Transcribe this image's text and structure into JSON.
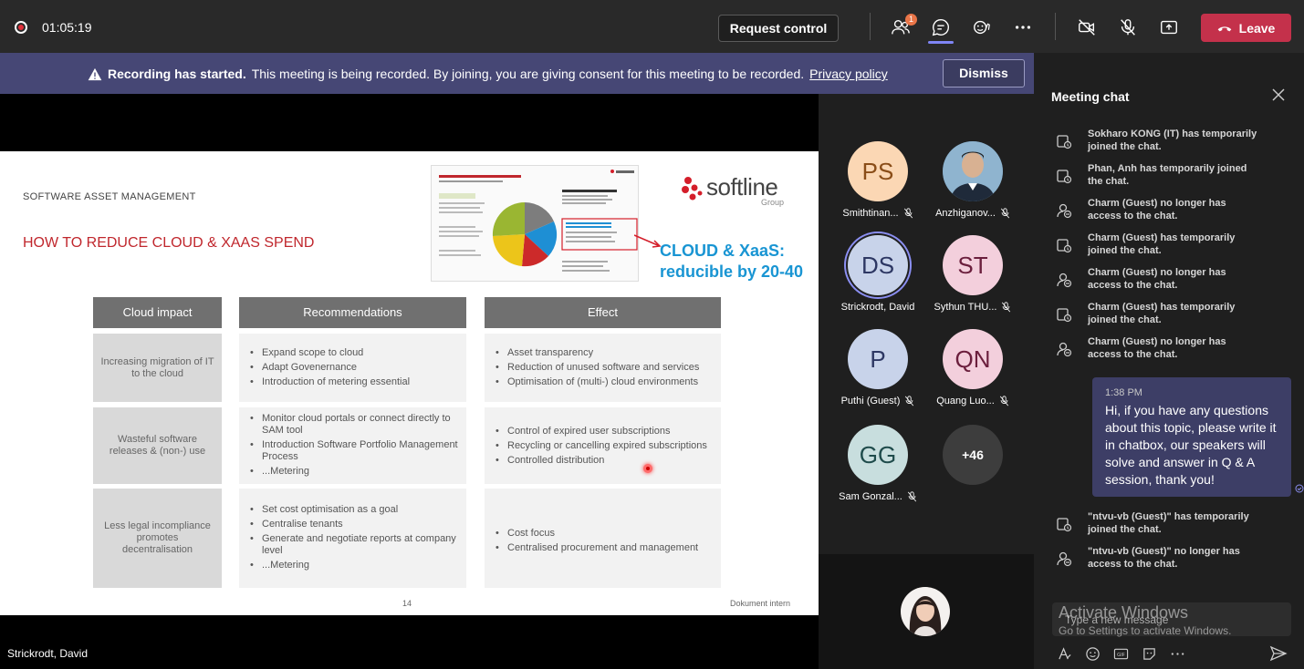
{
  "topbar": {
    "timer": "01:05:19",
    "request_control": "Request control",
    "people_badge": "1",
    "leave": "Leave"
  },
  "banner": {
    "bold": "Recording has started.",
    "text": "This meeting is being recorded. By joining, you are giving consent for this meeting to be recorded.",
    "link": "Privacy policy",
    "dismiss": "Dismiss"
  },
  "slide": {
    "subtitle": "SOFTWARE ASSET MANAGEMENT",
    "title": "HOW TO REDUCE CLOUD & XAAS SPEND",
    "logo": "softline",
    "logo_group": "Group",
    "callout_line1": "CLOUD & XaaS:",
    "callout_line2": "reducible by 20-40",
    "headers": [
      "Cloud impact",
      "Recommendations",
      "Effect"
    ],
    "rows": [
      {
        "impact": "Increasing migration of IT to the cloud",
        "recs": [
          "Expand scope to cloud",
          "Adapt Govenernance",
          "Introduction of metering essential"
        ],
        "effects": [
          "Asset transparency",
          "Reduction of unused software and services",
          "Optimisation of (multi-) cloud environments"
        ]
      },
      {
        "impact": "Wasteful software releases & (non-) use",
        "recs": [
          "Monitor cloud portals or connect directly to SAM tool",
          "Introduction Software Portfolio Management Process",
          "...Metering"
        ],
        "effects": [
          "Control of expired user subscriptions",
          "Recycling or cancelling expired subscriptions",
          "Controlled distribution"
        ]
      },
      {
        "impact": "Less legal incompliance promotes decentralisation",
        "recs": [
          "Set cost optimisation as a goal",
          "Centralise tenants",
          "Generate and negotiate reports at company level",
          "...Metering"
        ],
        "effects": [
          "Cost focus",
          "Centralised procurement and management"
        ]
      }
    ],
    "page": "14",
    "doc": "Dokument intern"
  },
  "presenter": "Strickrodt, David",
  "participants": [
    {
      "initials": "PS",
      "name": "Smithtinan...",
      "bg": "#fbd7b4",
      "muted": true
    },
    {
      "initials": "",
      "name": "Anzhiganov...",
      "bg": "#5a7a9a",
      "muted": true
    },
    {
      "initials": "DS",
      "name": "Strickrodt, David",
      "bg": "#c8d3ea",
      "muted": false
    },
    {
      "initials": "ST",
      "name": "Sythun THU...",
      "bg": "#f3cfdc",
      "muted": true
    },
    {
      "initials": "P",
      "name": "Puthi (Guest)",
      "bg": "#c8d3ea",
      "muted": true
    },
    {
      "initials": "QN",
      "name": "Quang Luo...",
      "bg": "#f3cfdc",
      "muted": true
    },
    {
      "initials": "GG",
      "name": "Sam Gonzal...",
      "bg": "#c8dede",
      "muted": true
    },
    {
      "initials": "+46",
      "name": "",
      "bg": "#3d3d3d",
      "muted": false
    }
  ],
  "chat": {
    "title": "Meeting chat",
    "system": [
      {
        "text": "Sokharo KONG (IT) has temporarily joined the chat.",
        "kind": "join"
      },
      {
        "text": "Phan, Anh has temporarily joined the chat.",
        "kind": "join"
      },
      {
        "text": "Charm (Guest) no longer has access to the chat.",
        "kind": "leave"
      },
      {
        "text": "Charm (Guest) has temporarily joined the chat.",
        "kind": "join"
      },
      {
        "text": "Charm (Guest) no longer has access to the chat.",
        "kind": "leave"
      },
      {
        "text": "Charm (Guest) has temporarily joined the chat.",
        "kind": "join"
      },
      {
        "text": "Charm (Guest) no longer has access to the chat.",
        "kind": "leave"
      }
    ],
    "message_time": "1:38 PM",
    "message": "Hi, if you have any questions about this topic, please write it in chatbox, our speakers will solve and answer in Q & A session, thank you!",
    "system_after": [
      {
        "text": "\"ntvu-vb (Guest)\" has temporarily joined the chat.",
        "kind": "join"
      },
      {
        "text": "\"ntvu-vb (Guest)\" no longer has access to the chat.",
        "kind": "leave"
      }
    ],
    "placeholder": "Type a new message"
  },
  "watermark": {
    "line1": "Activate Windows",
    "line2": "Go to Settings to activate Windows."
  }
}
